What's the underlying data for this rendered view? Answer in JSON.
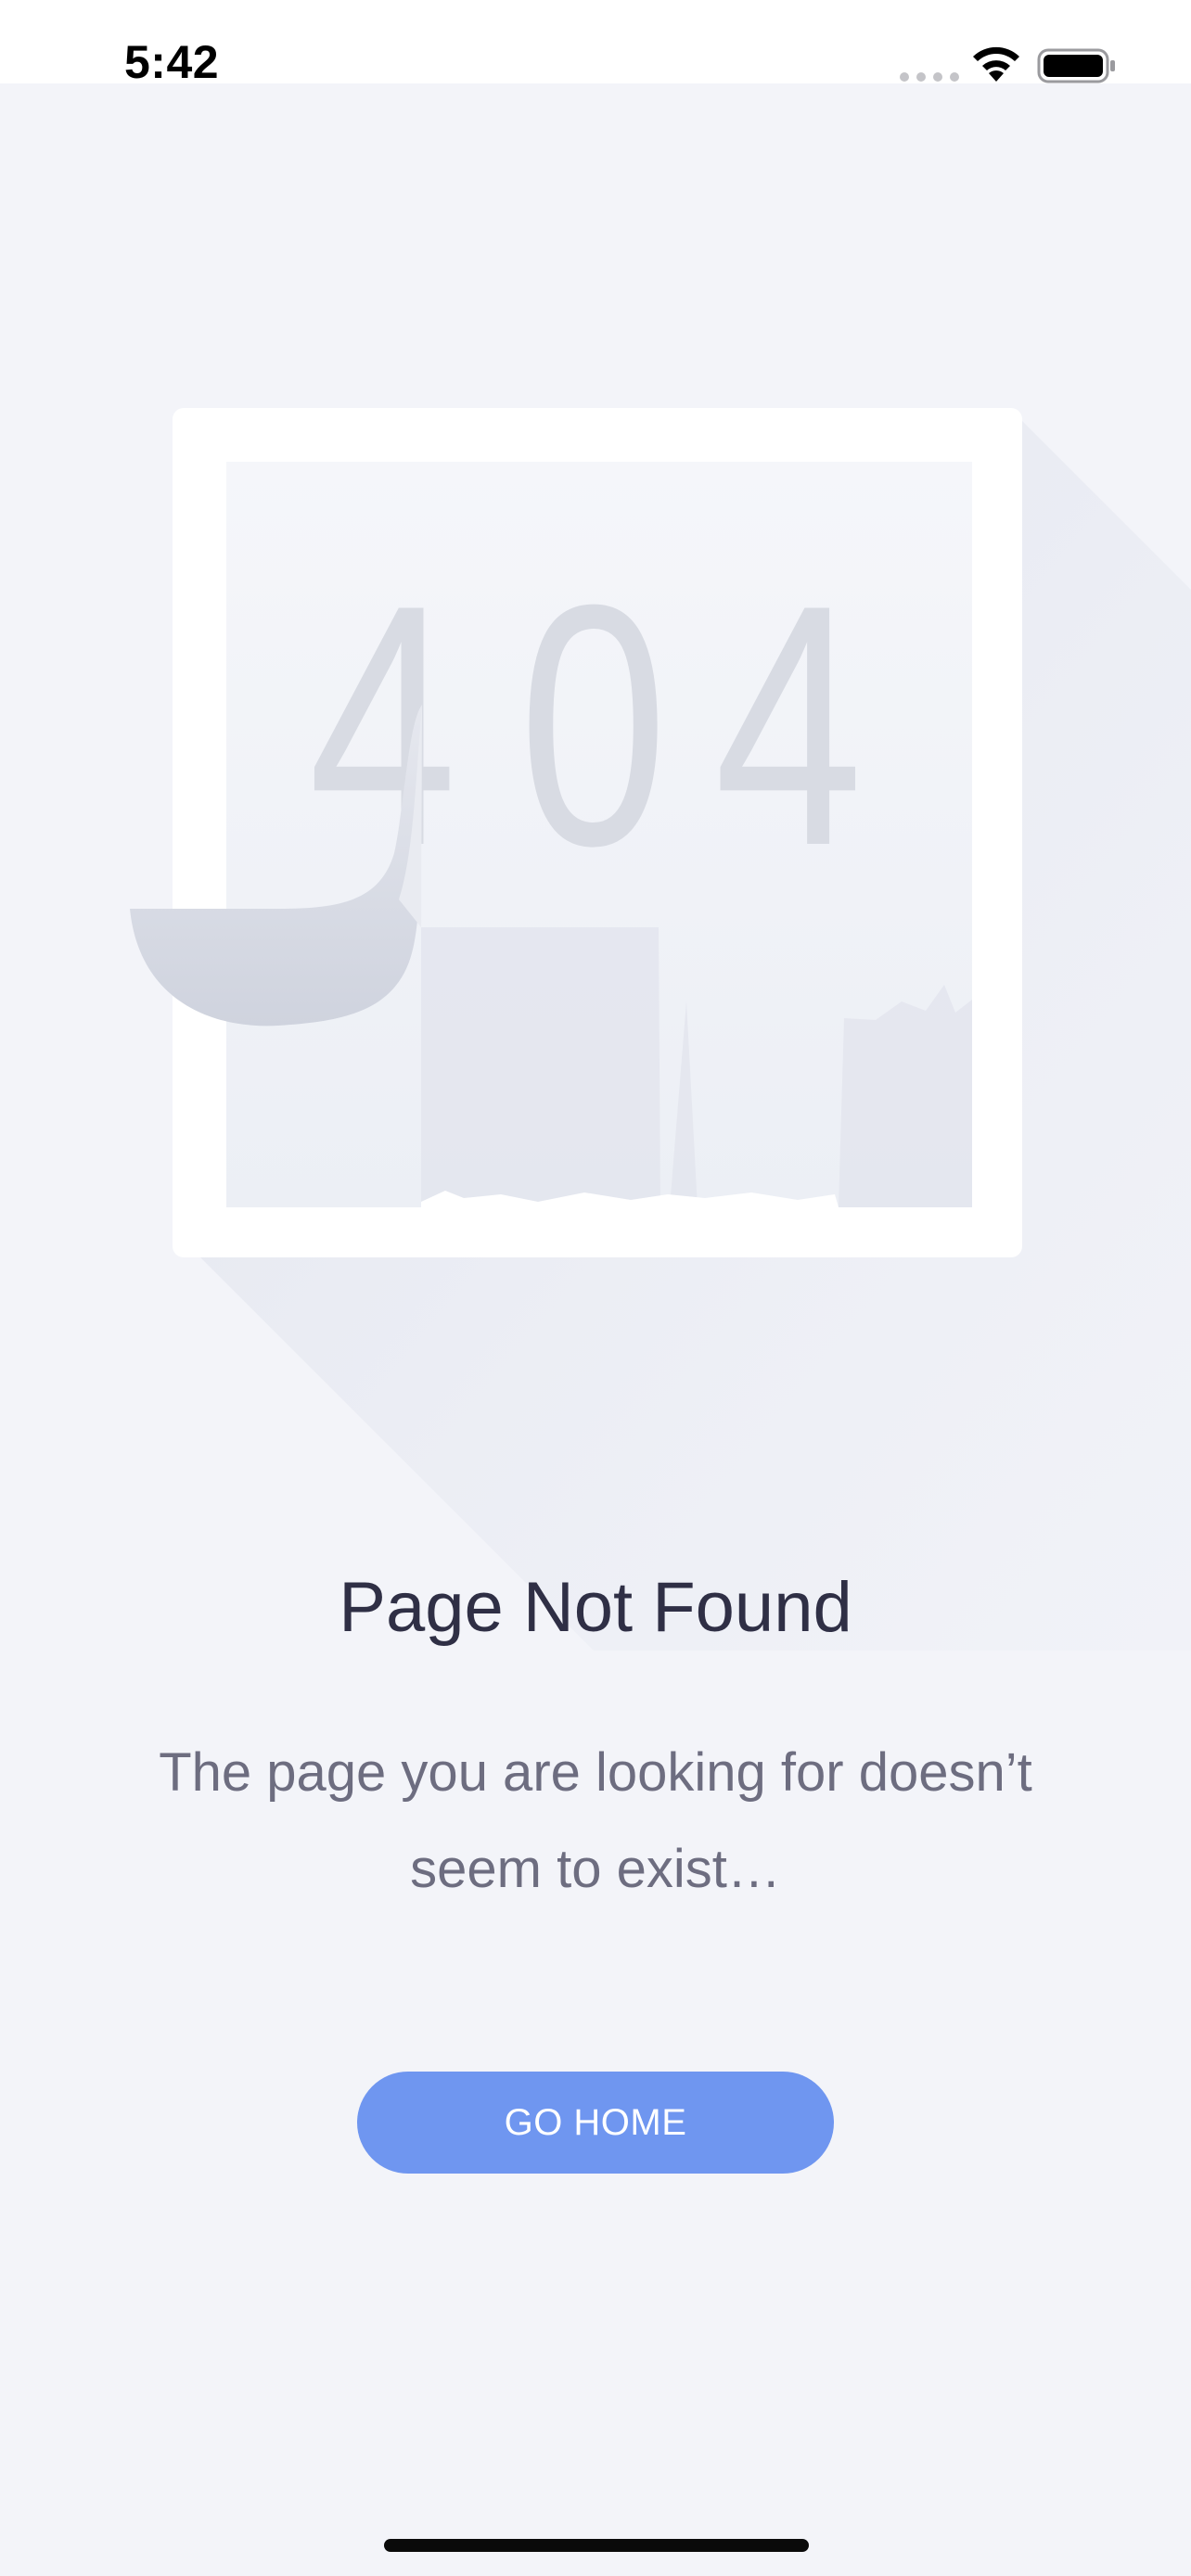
{
  "status_bar": {
    "time": "5:42"
  },
  "illustration": {
    "digit_1": "4",
    "digit_2": "0",
    "digit_3": "4"
  },
  "content": {
    "title": "Page Not Found",
    "subtitle": "The page you are looking for doesn’t seem to exist…"
  },
  "actions": {
    "go_home_label": "GO HOME"
  },
  "colors": {
    "background": "#f3f4f9",
    "button": "#6f96f0",
    "title": "#2f2f45",
    "subtitle": "#6d6d80"
  }
}
